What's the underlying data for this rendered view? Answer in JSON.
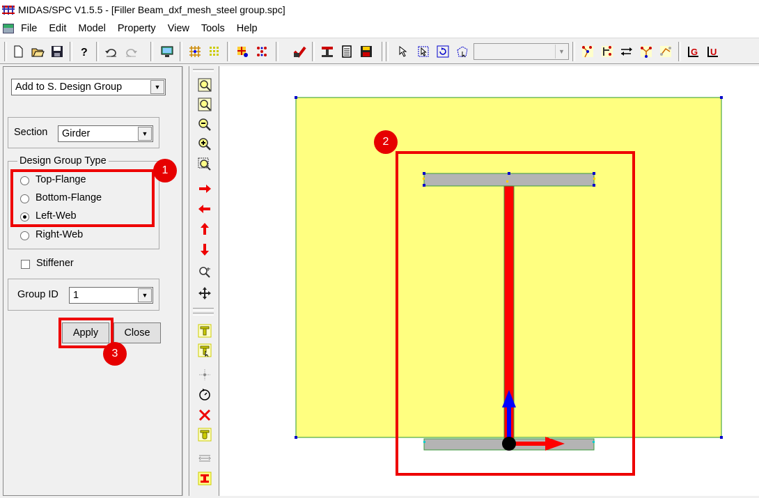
{
  "window": {
    "title": "MIDAS/SPC V1.5.5 - [Filler Beam_dxf_mesh_steel group.spc]"
  },
  "menu": [
    "File",
    "Edit",
    "Model",
    "Property",
    "View",
    "Tools",
    "Help"
  ],
  "toolbar": {
    "icons": [
      "new-icon",
      "open-icon",
      "save-icon",
      "help-icon",
      "undo-icon",
      "redo-icon",
      "display-icon",
      "grid-icon",
      "snap-icon",
      "mesh-icon",
      "node-icon",
      "section-icon",
      "table-icon",
      "calc-icon",
      "disk-icon",
      "select-icon",
      "window-select-icon",
      "rotate-select-icon",
      "polygon-select-icon",
      "node-tool-icon",
      "element-tool-icon",
      "move-icon",
      "copy-icon",
      "rotate-icon",
      "g-icon",
      "u-icon"
    ],
    "combo_value": ""
  },
  "panel": {
    "mode_select": "Add to S. Design Group",
    "section_label": "Section",
    "section_value": "Girder",
    "design_group_type_label": "Design Group Type",
    "options": [
      {
        "label": "Top-Flange",
        "checked": false
      },
      {
        "label": "Bottom-Flange",
        "checked": false
      },
      {
        "label": "Left-Web",
        "checked": true
      },
      {
        "label": "Right-Web",
        "checked": false
      }
    ],
    "stiffener_label": "Stiffener",
    "stiffener_checked": false,
    "group_id_label": "Group ID",
    "group_id_value": "1",
    "apply_label": "Apply",
    "close_label": "Close"
  },
  "callouts": [
    "1",
    "2",
    "3"
  ],
  "colors": {
    "highlight": "#e60000",
    "plate": "#ffff80",
    "flange": "#b4b4b4",
    "web_selected": "#ff0000",
    "axis_y": "#0000ff",
    "axis_x": "#ff0000"
  }
}
